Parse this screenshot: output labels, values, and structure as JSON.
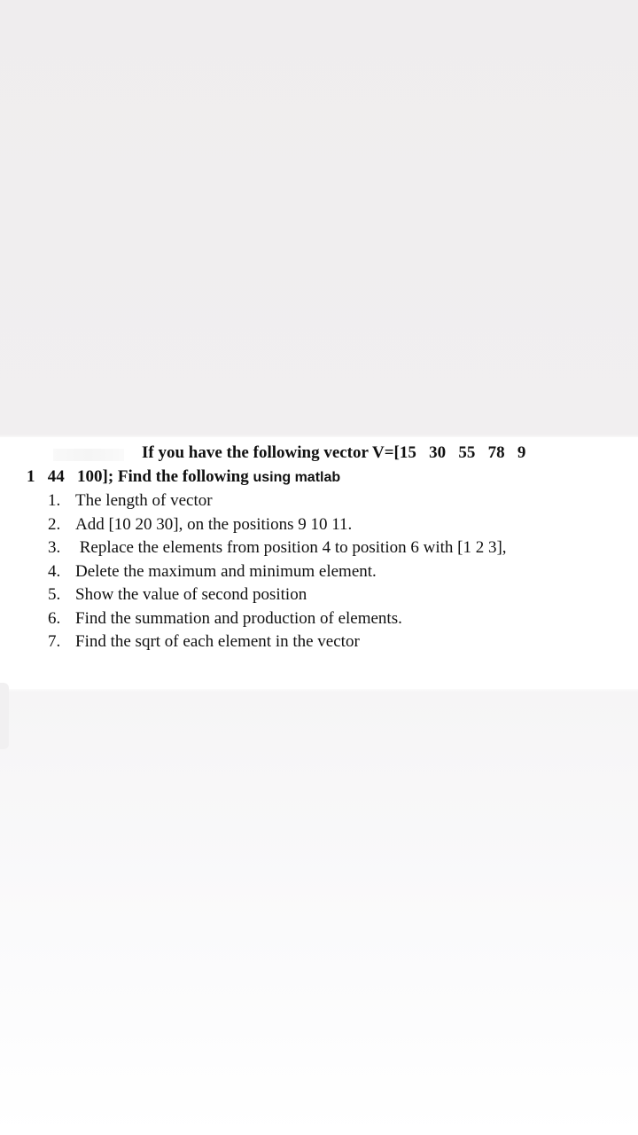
{
  "question": {
    "intro_line1": "If you have the following vector V=[15   30   55   78   9",
    "intro_line2_prefix": "1   44   100]; Find the following ",
    "intro_line2_suffix": "using matlab",
    "items": [
      {
        "number": "1.",
        "text": "The length of vector"
      },
      {
        "number": "2.",
        "text": "Add [10 20 30], on the positions 9 10 11."
      },
      {
        "number": "3.",
        "text": " Replace the elements from position 4 to position 6 with [1 2 3],"
      },
      {
        "number": "4.",
        "text": "Delete the maximum and minimum element."
      },
      {
        "number": "5.",
        "text": "Show the value of second position"
      },
      {
        "number": "6.",
        "text": "Find the summation and production of elements."
      },
      {
        "number": "7.",
        "text": "Find the sqrt of each element in the vector"
      }
    ]
  }
}
